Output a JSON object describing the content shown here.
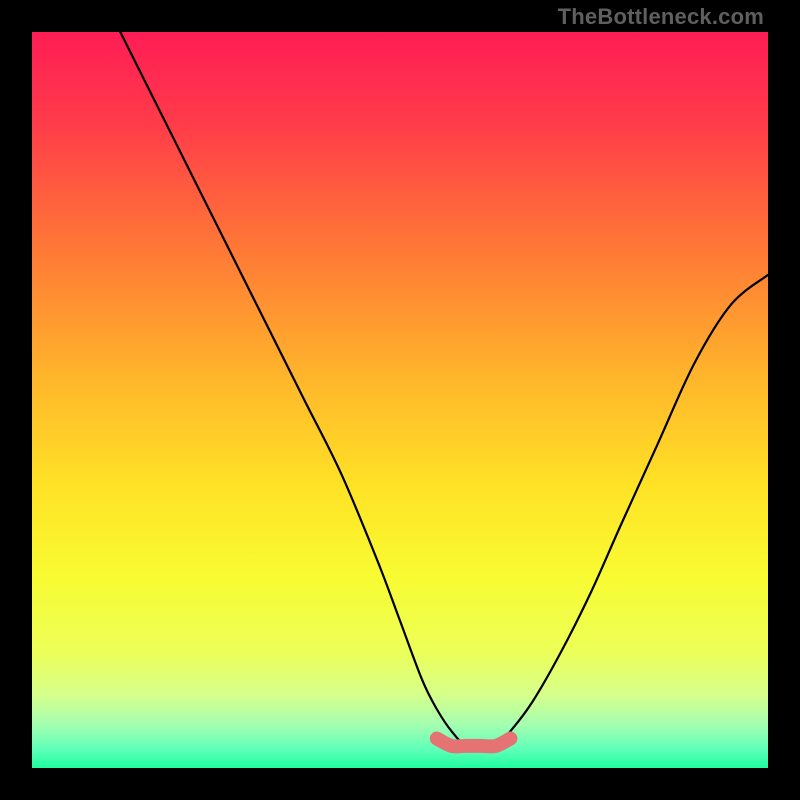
{
  "watermark": "TheBottleneck.com",
  "chart_data": {
    "type": "line",
    "title": "",
    "xlabel": "",
    "ylabel": "",
    "xlim": [
      0,
      100
    ],
    "ylim": [
      0,
      100
    ],
    "grid": false,
    "series": [
      {
        "name": "curve",
        "color": "#000000",
        "x": [
          12,
          17,
          22,
          27,
          32,
          37,
          42,
          47,
          50,
          53,
          55,
          57,
          59,
          61,
          63,
          65,
          68,
          72,
          76,
          80,
          85,
          90,
          95,
          100
        ],
        "y": [
          100,
          90,
          80,
          70,
          60,
          50,
          40,
          28,
          20,
          12,
          8,
          5,
          3,
          3,
          3,
          5,
          9,
          16,
          24,
          33,
          44,
          55,
          63,
          67
        ]
      },
      {
        "name": "flat-highlight",
        "color": "#e57373",
        "x": [
          55,
          57,
          59,
          61,
          63,
          65
        ],
        "y": [
          4,
          3,
          3,
          3,
          3,
          4
        ]
      }
    ],
    "gradient_stops": [
      {
        "offset": 0.0,
        "color": "#ff1d55"
      },
      {
        "offset": 0.12,
        "color": "#ff3a4a"
      },
      {
        "offset": 0.3,
        "color": "#ff7a36"
      },
      {
        "offset": 0.48,
        "color": "#ffb92a"
      },
      {
        "offset": 0.62,
        "color": "#ffe326"
      },
      {
        "offset": 0.74,
        "color": "#f8fb32"
      },
      {
        "offset": 0.84,
        "color": "#edff57"
      },
      {
        "offset": 0.9,
        "color": "#d6ff8a"
      },
      {
        "offset": 0.94,
        "color": "#a6ffb0"
      },
      {
        "offset": 0.975,
        "color": "#5fffb8"
      },
      {
        "offset": 1.0,
        "color": "#1effa0"
      }
    ]
  }
}
